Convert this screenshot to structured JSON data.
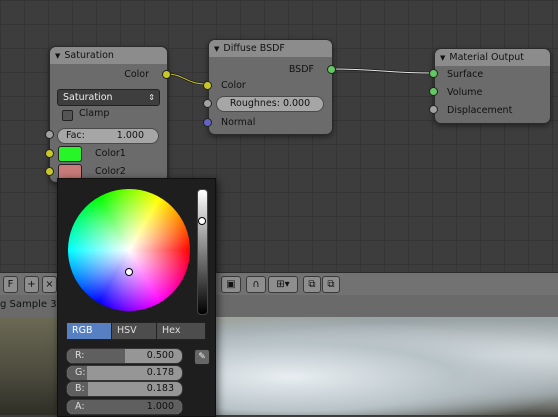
{
  "nodes": {
    "saturation": {
      "title": "Saturation",
      "output_color": "Color",
      "dropdown": "Saturation",
      "clamp_label": "Clamp",
      "fac_label": "Fac:",
      "fac_value": "1.000",
      "color1_label": "Color1",
      "color2_label": "Color2",
      "color1_hex": "#28f528",
      "color2_hex": "#c97a7a"
    },
    "diffuse": {
      "title": "Diffuse BSDF",
      "output_bsdf": "BSDF",
      "color_label": "Color",
      "roughness_field": "Roughnes: 0.000",
      "normal_label": "Normal"
    },
    "material_output": {
      "title": "Material Output",
      "surface": "Surface",
      "volume": "Volume",
      "displacement": "Displacement"
    }
  },
  "image_header": {
    "f_button": "F",
    "image_name": "g Sample 3."
  },
  "color_picker": {
    "tabs": [
      "RGB",
      "HSV",
      "Hex"
    ],
    "active_tab": "RGB",
    "r_label": "R:",
    "r_value": "0.500",
    "r_fraction": 0.5,
    "g_label": "G:",
    "g_value": "0.178",
    "g_fraction": 0.178,
    "b_label": "B:",
    "b_value": "0.183",
    "b_fraction": 0.183,
    "a_label": "A:",
    "a_value": "1.000",
    "a_fraction": 1.0
  },
  "colors": {
    "socket_yellow": "#c7c729",
    "socket_green": "#63c763",
    "socket_gray": "#a1a1a1",
    "socket_blue": "#6363c7",
    "active_tab": "#5680c2"
  }
}
